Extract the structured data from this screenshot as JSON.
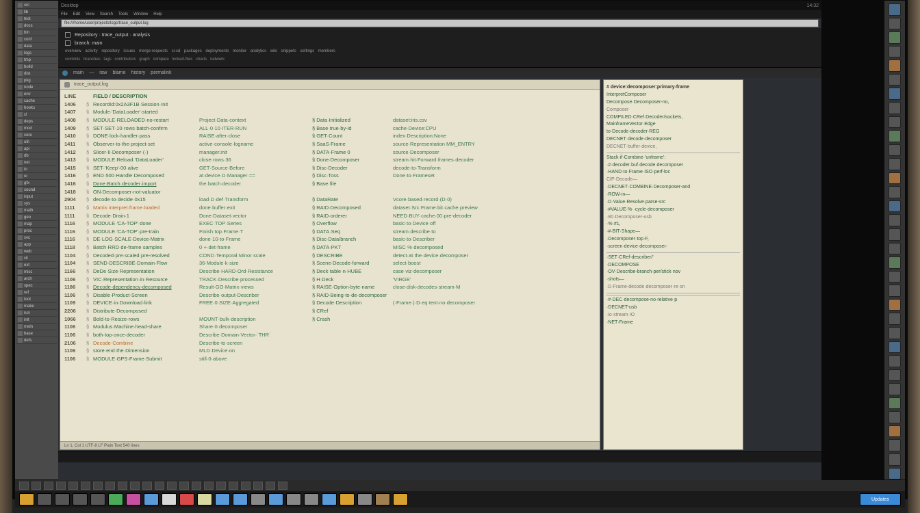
{
  "os": {
    "title": "Desktop",
    "clock": "14:32"
  },
  "menu": [
    "File",
    "Edit",
    "View",
    "Search",
    "Tools",
    "Window",
    "Help"
  ],
  "address": "file:///home/user/projects/logs/trace_output.log",
  "header": {
    "breadcrumb1": "Repository · trace_output · analysis",
    "breadcrumb2": "branch: main",
    "tags": "overview  activity  repository  issues  merge-requests  ci-cd  packages  deployments  monitor  analytics  wiki  snippets  settings  members",
    "tags2": "commits  branches  tags  contributors  graph  compare  locked-files  charts  network"
  },
  "toolrow": [
    "main",
    "—",
    "raw",
    "blame",
    "history",
    "permalink"
  ],
  "editor": {
    "tab": "trace_output.log",
    "header_row": [
      "LINE",
      "",
      "FIELD / DESCRIPTION",
      "",
      "",
      ""
    ],
    "status": "Ln 1, Col 1   UTF-8   LF   Plain Text   540 lines"
  },
  "rows": [
    {
      "ln": "1406",
      "c1": "RecordId:0x2A3F1B·Session·Init",
      "c2": "",
      "c3": "",
      "c4": ""
    },
    {
      "ln": "1407",
      "c1": "Module·'DataLoader'·started",
      "c2": "",
      "c3": "",
      "c4": ""
    },
    {
      "ln": "1408",
      "c1": "MODULE·RELOADED·no-restart",
      "c2": "Project·Data·context",
      "c3": "Data·Initialized",
      "c4": "dataset:iris.csv"
    },
    {
      "ln": "1409",
      "c1": "SET·SET·10·rows·batch-confirm",
      "c2": "ALL·0·10·ITER·RUN",
      "c3": "Base·true·by-id",
      "c4": "cache·Device:CPU"
    },
    {
      "ln": "1410",
      "c1": "DONE·lock·handler·pass",
      "c2": "RAISE·after·close",
      "c3": "GET·Count",
      "c4": "index·Description:None"
    },
    {
      "ln": "1411",
      "c1": "Observer·to·the·project·set",
      "c2": "active·console·logname",
      "c3": "SaaS·Frame",
      "c4": "source·Representation   MM_ENTRY"
    },
    {
      "ln": "1412",
      "c1": "Slicer·II·Decomposer·(·)",
      "c2": "manager.init",
      "c3": "DATA·Frame 0",
      "c4": "source·Decomposer"
    },
    {
      "ln": "1413",
      "c1": "MODULE·Reload·'DataLoader'",
      "c2": "close·rows·36",
      "c3": "Done·Decomposer",
      "c4": "stream·hit·Forward·frames·decoder"
    },
    {
      "ln": "1415",
      "c1": "SET·'Keep'·00·alive",
      "c2": "GET·Source·Before",
      "c3": "Disc·Decoder",
      "c4": "decode·to·Transform"
    },
    {
      "ln": "1416",
      "c1": "END·500·Handle·Decomposed",
      "c2": "at·device·D·Manager·==",
      "c3": "Disc·Toss",
      "c4": "Done·to·Frameset"
    },
    {
      "ln": "1416",
      "c1": "Done·Batch·decoder·import",
      "c2": "the·batch·decoder",
      "c3": "Base·file",
      "c4": "",
      "ul": true
    },
    {
      "ln": "1418",
      "c1": "ON·Decomposer·not-valuator",
      "c2": "",
      "c3": "",
      "c4": ""
    },
    {
      "ln": "2904",
      "c1": "decode·to·decide·0x15",
      "c2": "load·D·def·Transform",
      "c3": "DataRate",
      "c4": "Vcore·based·record·(D·0)"
    },
    {
      "ln": "1111",
      "c1": "Matrix·interpret·frame·loaded",
      "c2": "done·buffer·exit",
      "c3": "RAID·Decomposed",
      "c4": "dataset·Src·Frame·bit·cache·preview",
      "orange": true
    },
    {
      "ln": "1111",
      "c1": "Decode·Drain·1",
      "c2": "Done·Dataset·vector",
      "c3": "RAID·orderer",
      "c4": "NEED·BUY·cache·00·pre-decoder"
    },
    {
      "ln": "1116",
      "c1": "MODULE·'CA-TOP'·done",
      "c2": "EXEC·TOP·Series",
      "c3": "Overflow",
      "c4": "basic·to·Device·off"
    },
    {
      "ln": "1116",
      "c1": "MODULE·'CA-TOP'·pre-train",
      "c2": "Finish·top·Frame·T",
      "c3": "DATA·Seq",
      "c4": "stream·describe·to"
    },
    {
      "ln": "1116",
      "c1": "DE·LOG·SCALE·Device·Matrix",
      "c2": "done·10·to·Frame",
      "c3": "Disc·Data/branch",
      "c4": "basic·to·Describer"
    },
    {
      "ln": "1118",
      "c1": "Batch·RRD·de-frame·samples",
      "c2": "0·+·det·frame",
      "c3": "DATA·PKT",
      "c4": "MISC·%·decomposed"
    },
    {
      "ln": "1104",
      "c1": "Decoded·pre·scaled·pre-resolved",
      "c2": "COND·Temporal·Minor·scale",
      "c3": "DESCRIBE",
      "c4": "detect·at·the·device·decomposer"
    },
    {
      "ln": "1104",
      "c1": "SEND·DESCRIBE·Domain·Flow",
      "c2": "36·Module·k·size",
      "c3": "Scene·Decode·forward",
      "c4": "select·boost"
    },
    {
      "ln": "1166",
      "c1": "DeDe·Size·Representation",
      "c2": "Describe·HARD·Ord·Resistance",
      "c3": "Deck·table·n·HUBE",
      "c4": "case·viz·decomposer"
    },
    {
      "ln": "1106",
      "c1": "VIC·Representation·in·Resource",
      "c2": "TRACK·Describe·processed",
      "c3": "H·Deck",
      "c4": "'VIRGE'"
    },
    {
      "ln": "1186",
      "c1": "Decode·dependency·decomposed",
      "c2": "Result·GO·Matrix·views",
      "c3": "RAISE·Option·byte·name",
      "c4": "close·disk·decodes·stream·M",
      "ul": true
    },
    {
      "ln": "1106",
      "c1": "Disable·Product·Screen",
      "c2": "Describe·output·Describer",
      "c3": "RAID·Being·to·de·decomposer",
      "c4": ""
    },
    {
      "ln": "1109",
      "c1": "DEVICE·in·Download·link",
      "c2": "FREE·0·SIZE·Aggregated",
      "c3": "Decode·Description",
      "c4": "(·Frame·)·D·eq·tent·no·decomposer"
    },
    {
      "ln": "2206",
      "c1": "Distribute·Decomposed",
      "c2": "",
      "c3": "CRef",
      "c4": ""
    },
    {
      "ln": "1066",
      "c1": "Bold·to·Resize·rows",
      "c2": "MOUNT·bulk·description",
      "c3": "Crash",
      "c4": ""
    },
    {
      "ln": "1106",
      "c1": "Modulus·Machine·head-share",
      "c2": "Share·0·decomposer",
      "c3": "",
      "c4": ""
    },
    {
      "ln": "1106",
      "c1": "both·top·once·decoder",
      "c2": "Describe·Domain·Vector·`THR`",
      "c3": "",
      "c4": ""
    },
    {
      "ln": "2106",
      "c1": "Decode·Combine",
      "c2": "Describe·to·screen",
      "c3": "",
      "c4": "",
      "orange": true
    },
    {
      "ln": "1106",
      "c1": "store·end·the·Dimension",
      "c2": "MLD·Device·on",
      "c3": "",
      "c4": ""
    },
    {
      "ln": "1106",
      "c1": "MODULE·GPS·Frame·Submit",
      "c2": "still·0·above",
      "c3": "",
      "c4": ""
    }
  ],
  "sidepanel": [
    "# device:decomposer:primary-frame",
    "InterpretComposer",
    "Decompose·Decomposer-no,",
    "Composer",
    "COMPILED·CRef·Decoder/sockets,",
    "MainframeVector·Edge",
    "to·Decode·decoder·REG",
    "DECNET·decode·decomposer",
    "DECNET·buffer·device,",
    "",
    "Stack·if·Combine·'unframe':",
    "·#·decoder·buf·decode·decomposer",
    "·HAND·to·Frame·ISO·perf-loc",
    "CIP·Decode—",
    "·DECNET·COMBINE·Decomposer-and",
    "·ROW·in—",
    "·D·Value·Resolve·parse-src",
    "·#VALUE·%··cycle·decomposer",
    "·80·Decomposer-usb",
    "·%·#1,",
    "·#·BIT·Shape—",
    "·Decomposer·top·F,",
    "·screen·device·decomposer·",
    "",
    "·SET·CRef-describer/'",
    "·DECOMPOSE",
    "·OV·Describe-branch·per/stick·nov",
    "·shots—",
    "·D·Frame-decode·decomposer·re·on",
    "",
    "",
    "·#·DEC·decompose-no·relative·p",
    "·DECNET-usb",
    "·io·stream·IO",
    "·NET·Frame"
  ],
  "leftsb_items": [
    "src",
    "lib",
    "test",
    "docs",
    "bin",
    "conf",
    "data",
    "logs",
    "tmp",
    "build",
    "dist",
    "pkg",
    "node",
    "env",
    "cache",
    "hooks",
    "ci",
    "deps",
    "mod",
    "core",
    "util",
    "api",
    "db",
    "net",
    "io",
    "ui",
    "gfx",
    "sound",
    "input",
    "sys",
    "math",
    "geo",
    "map",
    "proc",
    "svc",
    "app",
    "web",
    "cli",
    "ext",
    "misc",
    "arch",
    "spec",
    "ref",
    "tool",
    "make",
    "run",
    "init",
    "main",
    "base",
    "defs"
  ],
  "rightsb_icons": [
    "b",
    "",
    "g",
    "",
    "o",
    "",
    "b",
    "",
    "",
    "g",
    "",
    "",
    "o",
    "",
    "b",
    "",
    "",
    "",
    "g",
    "",
    "",
    "o",
    "",
    "",
    "b",
    "",
    "",
    "",
    "g",
    "",
    "o",
    "",
    "",
    "b"
  ],
  "tray_icons": 22,
  "dock": [
    {
      "c": "#d8a030"
    },
    {
      "c": "#555"
    },
    {
      "c": "#555"
    },
    {
      "c": "#555"
    },
    {
      "c": "#555"
    },
    {
      "c": "#4aaa5a"
    },
    {
      "c": "#c850a0"
    },
    {
      "c": "#5a9ad8"
    },
    {
      "c": "#d8d8d8"
    },
    {
      "c": "#d84a4a"
    },
    {
      "c": "#d8d8a0"
    },
    {
      "c": "#5a9ad8"
    },
    {
      "c": "#5a9ad8"
    },
    {
      "c": "#888"
    },
    {
      "c": "#5a9ad8"
    },
    {
      "c": "#888"
    },
    {
      "c": "#888"
    },
    {
      "c": "#5a9ad8"
    },
    {
      "c": "#d8a030"
    },
    {
      "c": "#888"
    },
    {
      "c": "#a08050"
    },
    {
      "c": "#d8a030"
    }
  ],
  "dock_right": {
    "label": "Updates",
    "c": "#3a8ad8"
  }
}
